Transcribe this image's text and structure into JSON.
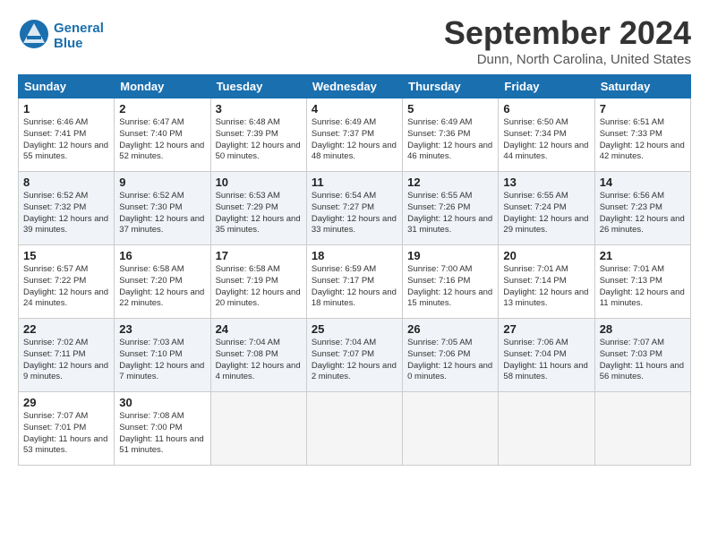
{
  "header": {
    "logo_line1": "General",
    "logo_line2": "Blue",
    "title": "September 2024",
    "location": "Dunn, North Carolina, United States"
  },
  "weekdays": [
    "Sunday",
    "Monday",
    "Tuesday",
    "Wednesday",
    "Thursday",
    "Friday",
    "Saturday"
  ],
  "weeks": [
    [
      {
        "day": "1",
        "sunrise": "6:46 AM",
        "sunset": "7:41 PM",
        "daylight": "12 hours and 55 minutes."
      },
      {
        "day": "2",
        "sunrise": "6:47 AM",
        "sunset": "7:40 PM",
        "daylight": "12 hours and 52 minutes."
      },
      {
        "day": "3",
        "sunrise": "6:48 AM",
        "sunset": "7:39 PM",
        "daylight": "12 hours and 50 minutes."
      },
      {
        "day": "4",
        "sunrise": "6:49 AM",
        "sunset": "7:37 PM",
        "daylight": "12 hours and 48 minutes."
      },
      {
        "day": "5",
        "sunrise": "6:49 AM",
        "sunset": "7:36 PM",
        "daylight": "12 hours and 46 minutes."
      },
      {
        "day": "6",
        "sunrise": "6:50 AM",
        "sunset": "7:34 PM",
        "daylight": "12 hours and 44 minutes."
      },
      {
        "day": "7",
        "sunrise": "6:51 AM",
        "sunset": "7:33 PM",
        "daylight": "12 hours and 42 minutes."
      }
    ],
    [
      {
        "day": "8",
        "sunrise": "6:52 AM",
        "sunset": "7:32 PM",
        "daylight": "12 hours and 39 minutes."
      },
      {
        "day": "9",
        "sunrise": "6:52 AM",
        "sunset": "7:30 PM",
        "daylight": "12 hours and 37 minutes."
      },
      {
        "day": "10",
        "sunrise": "6:53 AM",
        "sunset": "7:29 PM",
        "daylight": "12 hours and 35 minutes."
      },
      {
        "day": "11",
        "sunrise": "6:54 AM",
        "sunset": "7:27 PM",
        "daylight": "12 hours and 33 minutes."
      },
      {
        "day": "12",
        "sunrise": "6:55 AM",
        "sunset": "7:26 PM",
        "daylight": "12 hours and 31 minutes."
      },
      {
        "day": "13",
        "sunrise": "6:55 AM",
        "sunset": "7:24 PM",
        "daylight": "12 hours and 29 minutes."
      },
      {
        "day": "14",
        "sunrise": "6:56 AM",
        "sunset": "7:23 PM",
        "daylight": "12 hours and 26 minutes."
      }
    ],
    [
      {
        "day": "15",
        "sunrise": "6:57 AM",
        "sunset": "7:22 PM",
        "daylight": "12 hours and 24 minutes."
      },
      {
        "day": "16",
        "sunrise": "6:58 AM",
        "sunset": "7:20 PM",
        "daylight": "12 hours and 22 minutes."
      },
      {
        "day": "17",
        "sunrise": "6:58 AM",
        "sunset": "7:19 PM",
        "daylight": "12 hours and 20 minutes."
      },
      {
        "day": "18",
        "sunrise": "6:59 AM",
        "sunset": "7:17 PM",
        "daylight": "12 hours and 18 minutes."
      },
      {
        "day": "19",
        "sunrise": "7:00 AM",
        "sunset": "7:16 PM",
        "daylight": "12 hours and 15 minutes."
      },
      {
        "day": "20",
        "sunrise": "7:01 AM",
        "sunset": "7:14 PM",
        "daylight": "12 hours and 13 minutes."
      },
      {
        "day": "21",
        "sunrise": "7:01 AM",
        "sunset": "7:13 PM",
        "daylight": "12 hours and 11 minutes."
      }
    ],
    [
      {
        "day": "22",
        "sunrise": "7:02 AM",
        "sunset": "7:11 PM",
        "daylight": "12 hours and 9 minutes."
      },
      {
        "day": "23",
        "sunrise": "7:03 AM",
        "sunset": "7:10 PM",
        "daylight": "12 hours and 7 minutes."
      },
      {
        "day": "24",
        "sunrise": "7:04 AM",
        "sunset": "7:08 PM",
        "daylight": "12 hours and 4 minutes."
      },
      {
        "day": "25",
        "sunrise": "7:04 AM",
        "sunset": "7:07 PM",
        "daylight": "12 hours and 2 minutes."
      },
      {
        "day": "26",
        "sunrise": "7:05 AM",
        "sunset": "7:06 PM",
        "daylight": "12 hours and 0 minutes."
      },
      {
        "day": "27",
        "sunrise": "7:06 AM",
        "sunset": "7:04 PM",
        "daylight": "11 hours and 58 minutes."
      },
      {
        "day": "28",
        "sunrise": "7:07 AM",
        "sunset": "7:03 PM",
        "daylight": "11 hours and 56 minutes."
      }
    ],
    [
      {
        "day": "29",
        "sunrise": "7:07 AM",
        "sunset": "7:01 PM",
        "daylight": "11 hours and 53 minutes."
      },
      {
        "day": "30",
        "sunrise": "7:08 AM",
        "sunset": "7:00 PM",
        "daylight": "11 hours and 51 minutes."
      },
      null,
      null,
      null,
      null,
      null
    ]
  ]
}
